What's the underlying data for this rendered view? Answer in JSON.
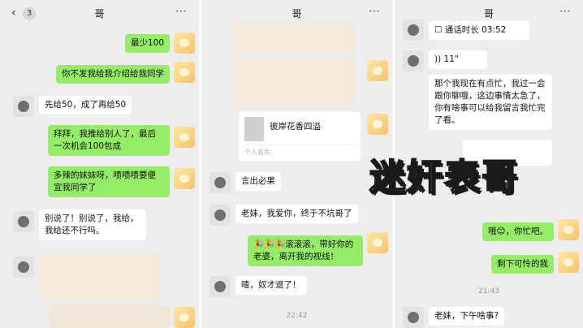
{
  "overlay": {
    "text": "迷奸表哥"
  },
  "panel1": {
    "back_icon": "‹",
    "unread_count": "3",
    "title": "哥",
    "more_icon": "⋯",
    "messages": [
      "最少100",
      "你不发我给我介绍给我同学",
      "先给50，成了再给50",
      "拜拜，我推给别人了，最后一次机会100包成",
      "多辣的妹妹呀，啧啧啧要便宜我同学了",
      "别说了！别说了，我给，我给还不行吗。"
    ]
  },
  "panel2": {
    "title": "哥",
    "more_icon": "⋯",
    "card_title": "彼岸花香四溢",
    "card_sub": "个人名片",
    "messages": [
      "言出必果",
      "老妹，我爱你，终于不坑哥了",
      "🎉🎉🎉滚滚滚，带好你的老婆，离开我的视线！",
      "喳，奴才退了！"
    ],
    "time": "22:42"
  },
  "panel3": {
    "title": "哥",
    "more_icon": "⋯",
    "call_duration": "通话时长 03:52",
    "voice_len": "11\"",
    "messages": [
      "那个我现在有点忙，我过一会跟你聊哦，这边事情太急了，你有啥事可以给我留言我忙完了看。",
      "哦😊，你忙吧。",
      "剩下可怜的我",
      "老妹，下午啥事?"
    ],
    "time": "21:43"
  }
}
